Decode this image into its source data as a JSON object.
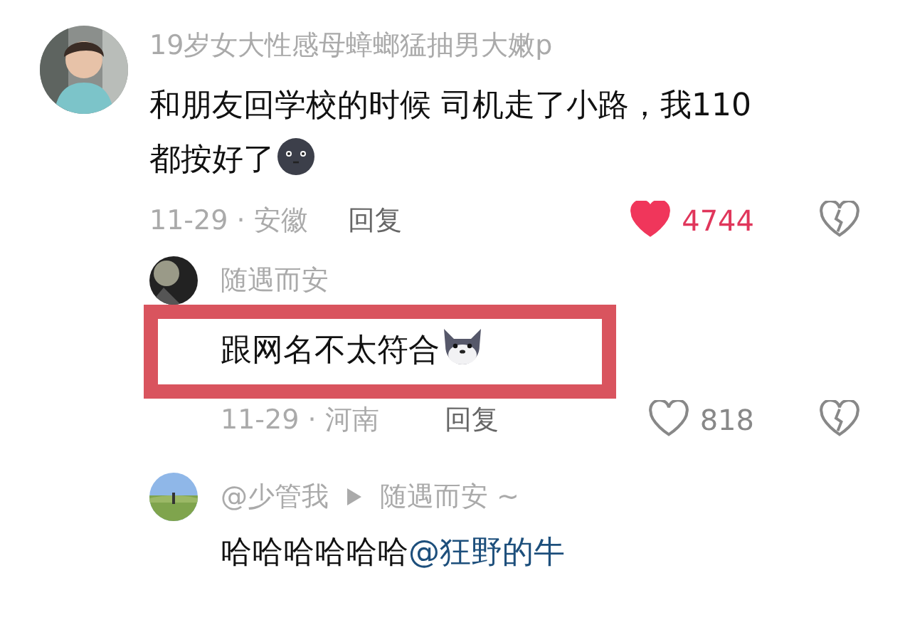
{
  "comments": [
    {
      "author": "19岁女大性感母蟑螂猛抽男大嫩p",
      "text": "和朋友回学校的时候 司机走了小路，我110都按好了",
      "emoji": {
        "kind": "round-face"
      },
      "date": "11-29 · 安徽",
      "reply": "回复",
      "liked": true,
      "likes": "4744",
      "replies": [
        {
          "kind": "reply",
          "author": "随遇而安",
          "text": "跟网名不太符合",
          "emoji": {
            "kind": "dog"
          },
          "highlighted": true,
          "date": "11-29 · 河南",
          "reply": "回复",
          "liked": false,
          "likes": "818"
        },
        {
          "kind": "reply_to",
          "author": "@少管我",
          "reply_to": "随遇而安 ~",
          "text": "哈哈哈哈哈哈",
          "mention": "@狂野的牛",
          "highlighted": false
        }
      ]
    }
  ]
}
